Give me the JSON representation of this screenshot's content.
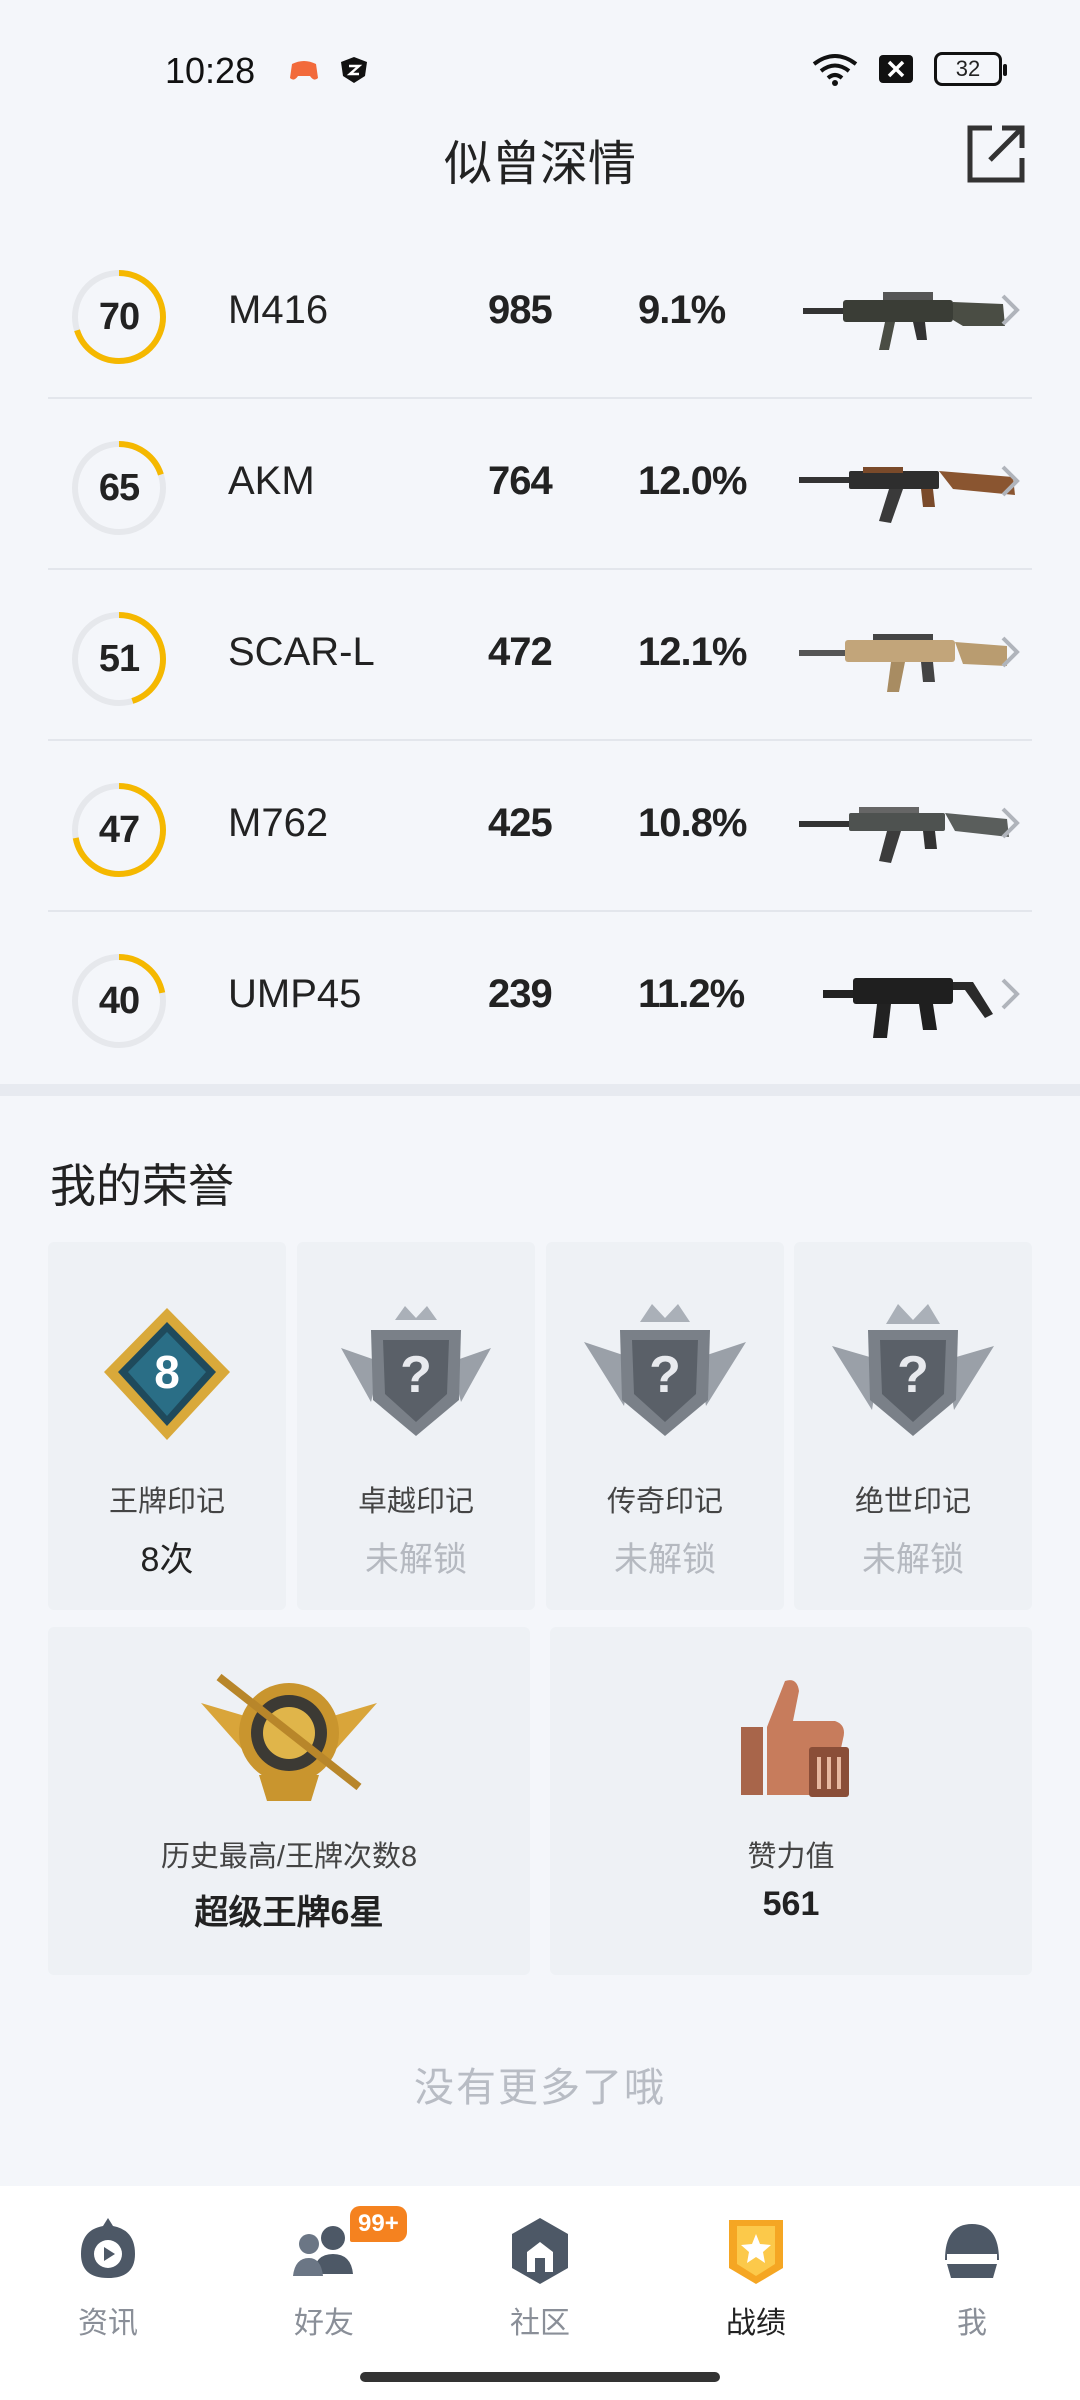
{
  "status": {
    "time": "10:28",
    "battery": "32"
  },
  "header": {
    "title": "似曾深情"
  },
  "weapons": [
    {
      "score": "70",
      "progress": 0.7,
      "name": "M416",
      "count": "985",
      "rate": "9.1%"
    },
    {
      "score": "65",
      "progress": 0.2,
      "name": "AKM",
      "count": "764",
      "rate": "12.0%"
    },
    {
      "score": "51",
      "progress": 0.45,
      "name": "SCAR-L",
      "count": "472",
      "rate": "12.1%"
    },
    {
      "score": "47",
      "progress": 0.72,
      "name": "M762",
      "count": "425",
      "rate": "10.8%"
    },
    {
      "score": "40",
      "progress": 0.22,
      "name": "UMP45",
      "count": "239",
      "rate": "11.2%"
    }
  ],
  "honor": {
    "title": "我的荣誉",
    "medals": [
      {
        "name": "王牌印记",
        "value": "8次",
        "badge_num": "8"
      },
      {
        "name": "卓越印记",
        "value": "未解锁"
      },
      {
        "name": "传奇印记",
        "value": "未解锁"
      },
      {
        "name": "绝世印记",
        "value": "未解锁"
      }
    ],
    "highest": {
      "label": "历史最高/王牌次数8",
      "value": "超级王牌6星"
    },
    "likes": {
      "label": "赞力值",
      "value": "561"
    }
  },
  "footer_text": "没有更多了哦",
  "nav": {
    "items": [
      {
        "label": "资讯"
      },
      {
        "label": "好友",
        "badge": "99+"
      },
      {
        "label": "社区"
      },
      {
        "label": "战绩"
      },
      {
        "label": "我"
      }
    ]
  },
  "colors": {
    "accent": "#f5b800",
    "track": "#e6e8ec",
    "badge": "#f5821f"
  }
}
